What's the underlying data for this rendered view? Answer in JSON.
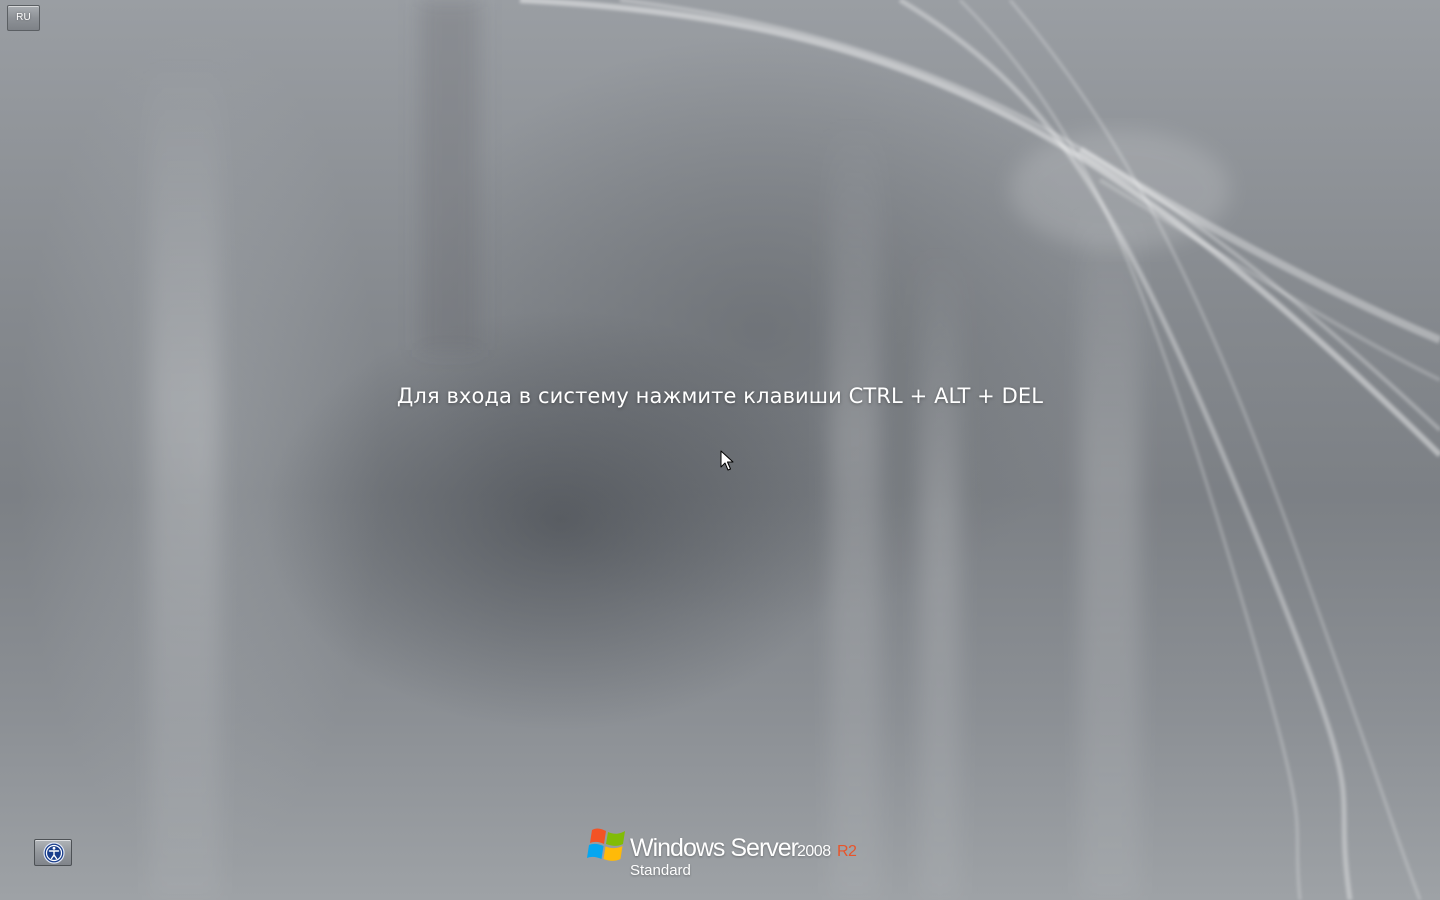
{
  "language_indicator": {
    "label": "RU"
  },
  "login_prompt": {
    "text": "Для входа в систему нажмите клавиши CTRL + ALT + DEL"
  },
  "ease_of_access": {
    "icon": "ease-of-access-icon"
  },
  "branding": {
    "product_name": "Windows Server",
    "version": "2008",
    "release": "R2",
    "edition": "Standard",
    "release_color": "#e8542a",
    "logo_icon": "windows-flag-icon"
  },
  "cursor": {
    "icon": "mouse-pointer-icon"
  }
}
